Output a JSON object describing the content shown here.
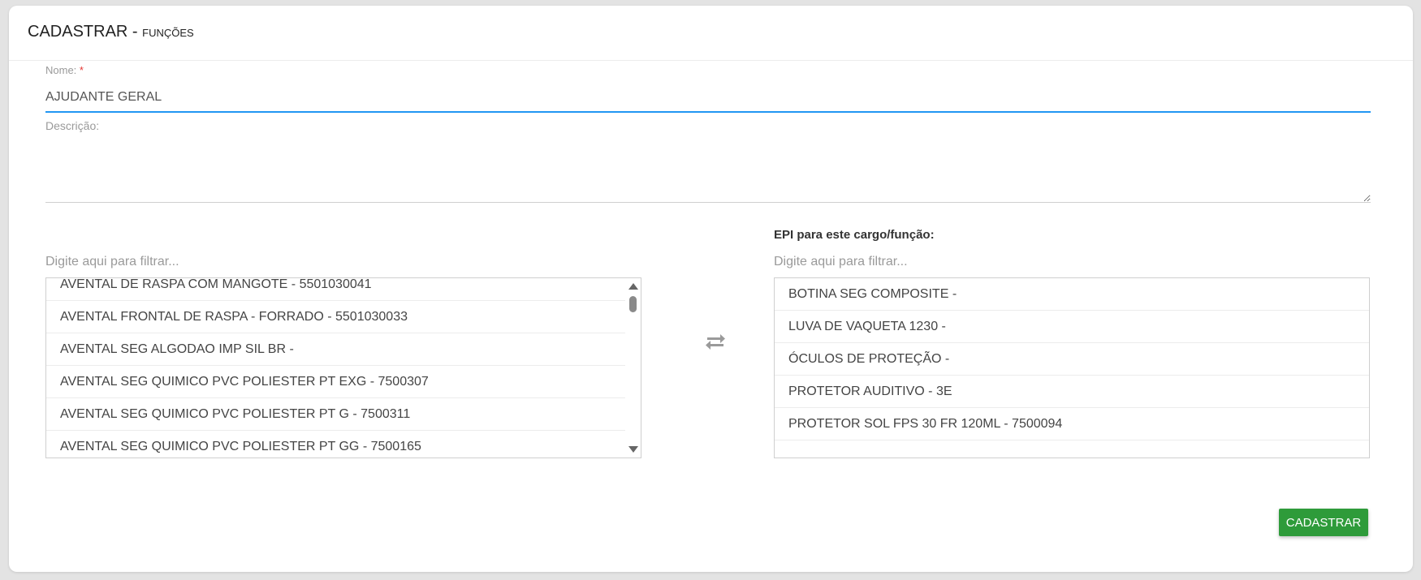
{
  "header": {
    "title": "CADASTRAR",
    "separator": " - ",
    "subtitle": "FUNÇÕES"
  },
  "form": {
    "name": {
      "label": "Nome:",
      "required_mark": "*",
      "value": "AJUDANTE GERAL"
    },
    "description": {
      "label": "Descrição:",
      "value": ""
    }
  },
  "available_list": {
    "filter_placeholder": "Digite aqui para filtrar...",
    "items": [
      "AVENTAL DE RASPA COM MANGOTE - 5501030041",
      "AVENTAL FRONTAL DE RASPA - FORRADO - 5501030033",
      "AVENTAL SEG ALGODAO IMP SIL BR -",
      "AVENTAL SEG QUIMICO PVC POLIESTER PT EXG - 7500307",
      "AVENTAL SEG QUIMICO PVC POLIESTER PT G - 7500311",
      "AVENTAL SEG QUIMICO PVC POLIESTER PT GG - 7500165"
    ]
  },
  "selected_list": {
    "label": "EPI para este cargo/função:",
    "filter_placeholder": "Digite aqui para filtrar...",
    "items": [
      "BOTINA SEG COMPOSITE -",
      "LUVA DE VAQUETA 1230 -",
      "ÓCULOS DE PROTEÇÃO -",
      "PROTETOR AUDITIVO - 3E",
      "PROTETOR SOL FPS 30 FR 120ML - 7500094"
    ]
  },
  "actions": {
    "submit_label": "CADASTRAR"
  },
  "colors": {
    "accent": "#2196f3",
    "submit": "#2e9b3a",
    "required": "#e53935"
  },
  "icons": {
    "transfer": "swap-arrows-icon"
  }
}
